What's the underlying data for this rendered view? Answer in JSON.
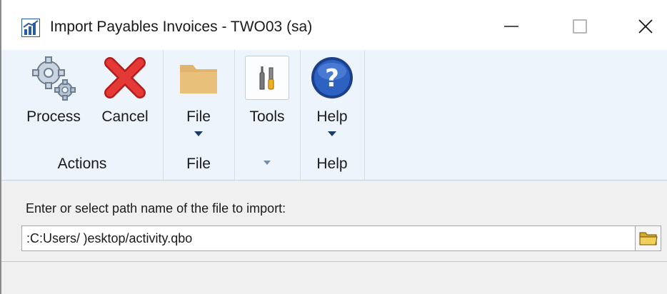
{
  "window": {
    "title": "Import Payables Invoices  -  TWO03 (sa)",
    "icon": "chart-bars-icon"
  },
  "titlebar_controls": {
    "minimize": "minimize-icon",
    "maximize": "maximize-icon",
    "close": "close-icon"
  },
  "ribbon": {
    "groups": [
      {
        "label": "Actions",
        "buttons": [
          {
            "label": "Process",
            "icon": "gears-icon"
          },
          {
            "label": "Cancel",
            "icon": "red-x-icon"
          }
        ]
      },
      {
        "label": "File",
        "buttons": [
          {
            "label": "File",
            "icon": "folder-icon",
            "dropdown": true
          }
        ]
      },
      {
        "label": "",
        "buttons": [
          {
            "label": "Tools",
            "icon": "tools-icon"
          }
        ]
      },
      {
        "label": "Help",
        "buttons": [
          {
            "label": "Help",
            "icon": "help-question-icon",
            "dropdown": true
          }
        ]
      }
    ]
  },
  "form": {
    "prompt": "Enter or select path name of the file to import:",
    "path_value": ":C:Users/ )esktop/activity.qbo",
    "browse_icon": "folder-icon"
  },
  "colors": {
    "ribbon_bg": "#eef4fc",
    "cancel_red": "#e02424",
    "help_blue": "#1f4fa8",
    "folder_tan": "#e8c07a"
  }
}
